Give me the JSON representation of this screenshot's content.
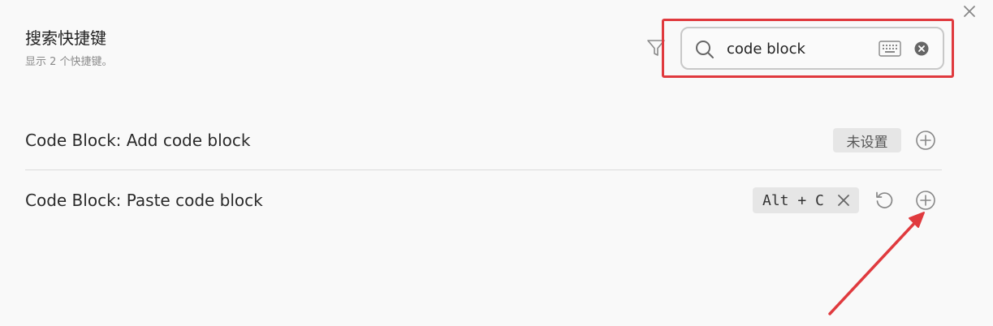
{
  "header": {
    "title": "搜索快捷键",
    "subtitle": "显示 2 个快捷键。"
  },
  "search": {
    "value": "code block",
    "placeholder": ""
  },
  "hotkeys": [
    {
      "label": "Code Block: Add code block",
      "status": "未设置"
    },
    {
      "label": "Code Block: Paste code block",
      "shortcut": "Alt + C"
    }
  ],
  "icons": {
    "close": "close-icon",
    "filter": "filter-icon",
    "search": "search-icon",
    "keyboard": "keyboard-icon",
    "clear": "clear-icon",
    "add": "plus-circle-icon",
    "reset": "reset-icon",
    "remove": "x-icon"
  },
  "colors": {
    "annotation": "#e03a3e",
    "background": "#f9f9f9",
    "chip": "#e6e6e6"
  }
}
